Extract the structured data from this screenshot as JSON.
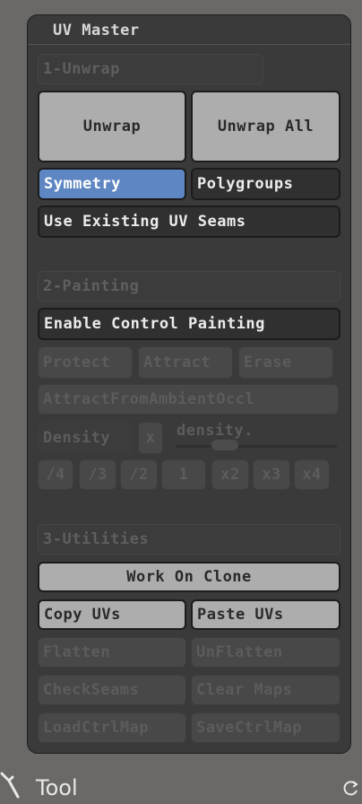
{
  "panel": {
    "title": "UV Master"
  },
  "unwrap": {
    "section_label": "1-Unwrap",
    "unwrap_label": "Unwrap",
    "unwrap_all_label": "Unwrap All",
    "symmetry_label": "Symmetry",
    "polygroups_label": "Polygroups",
    "use_existing_seams_label": "Use Existing UV Seams"
  },
  "painting": {
    "section_label": "2-Painting",
    "enable_label": "Enable Control Painting",
    "protect_label": "Protect",
    "attract_label": "Attract",
    "erase_label": "Erase",
    "attract_ao_label": "AttractFromAmbientOccl",
    "density_label": "Density",
    "density_x_label": "x",
    "density_slider_label": "density.",
    "factors": [
      "/4",
      "/3",
      "/2",
      "1",
      "x2",
      "x3",
      "x4"
    ]
  },
  "utilities": {
    "section_label": "3-Utilities",
    "work_on_clone_label": "Work On Clone",
    "copy_uvs_label": "Copy UVs",
    "paste_uvs_label": "Paste UVs",
    "flatten_label": "Flatten",
    "unflatten_label": "UnFlatten",
    "check_seams_label": "CheckSeams",
    "clear_maps_label": "Clear Maps",
    "load_ctrl_map_label": "LoadCtrlMap",
    "save_ctrl_map_label": "SaveCtrlMap"
  },
  "footer": {
    "tool_label": "Tool"
  },
  "icons": {
    "tool": "tool-icon",
    "rotate": "rotate-icon"
  },
  "colors": {
    "accent": "#5e86c2",
    "panel": "#3a3a3a",
    "button": "#adadad"
  }
}
